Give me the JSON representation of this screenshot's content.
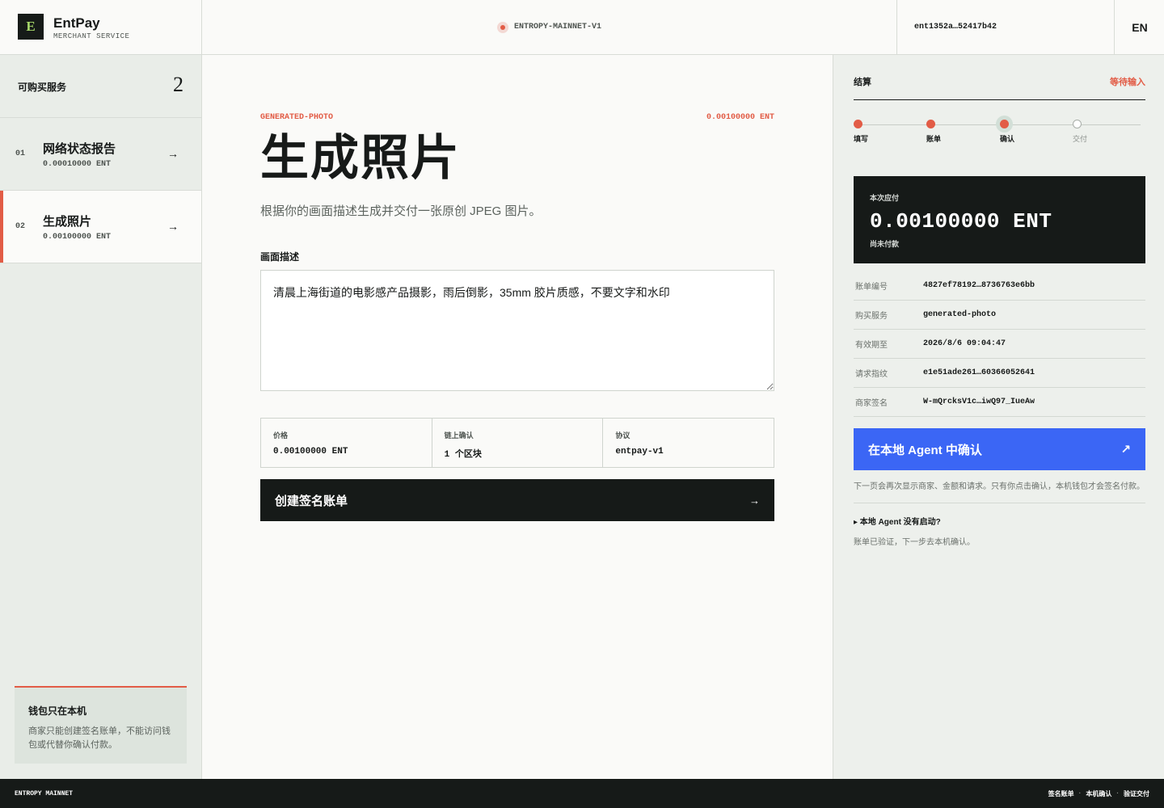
{
  "header": {
    "logo_letter": "E",
    "brand_name": "EntPay",
    "brand_sub": "MERCHANT SERVICE",
    "network": "ENTROPY-MAINNET-V1",
    "account": "ent1352a…52417b42",
    "language": "EN"
  },
  "sidebar": {
    "heading": "可购买服务",
    "count": "2",
    "services": [
      {
        "num": "01",
        "name": "网络状态报告",
        "price": "0.00010000 ENT",
        "arrow": "→",
        "active": false
      },
      {
        "num": "02",
        "name": "生成照片",
        "price": "0.00100000 ENT",
        "arrow": "→",
        "active": true
      }
    ],
    "notice": {
      "title": "钱包只在本机",
      "body": "商家只能创建签名账单，不能访问钱包或代替你确认付款。"
    }
  },
  "main": {
    "service_id": "GENERATED-PHOTO",
    "service_price": "0.00100000 ENT",
    "title": "生成照片",
    "description": "根据你的画面描述生成并交付一张原创 JPEG 图片。",
    "prompt_label": "画面描述",
    "prompt_value": "清晨上海街道的电影感产品摄影，雨后倒影，35mm 胶片质感，不要文字和水印",
    "stats": [
      {
        "label": "价格",
        "value": "0.00100000 ENT"
      },
      {
        "label": "链上确认",
        "value": "1 个区块"
      },
      {
        "label": "协议",
        "value": "entpay-v1"
      }
    ],
    "create_button": "创建签名账单",
    "create_arrow": "→"
  },
  "checkout": {
    "heading": "结算",
    "status": "等待输入",
    "steps": [
      {
        "label": "填写",
        "state": "done"
      },
      {
        "label": "账单",
        "state": "done"
      },
      {
        "label": "确认",
        "state": "current"
      },
      {
        "label": "交付",
        "state": "pending"
      }
    ],
    "amount_label": "本次应付",
    "amount": "0.00100000 ENT",
    "amount_status": "尚未付款",
    "details": [
      {
        "key": "账单编号",
        "value": "4827ef78192…8736763e6bb"
      },
      {
        "key": "购买服务",
        "value": "generated-photo"
      },
      {
        "key": "有效期至",
        "value": "2026/8/6 09:04:47"
      },
      {
        "key": "请求指纹",
        "value": "e1e51ade261…60366052641"
      },
      {
        "key": "商家签名",
        "value": "W-mQrcksV1c…iwQ97_IueAw"
      }
    ],
    "agent_button": "在本地 Agent 中确认",
    "agent_arrow": "↗",
    "agent_note": "下一页会再次显示商家、金额和请求。只有你点击确认，本机钱包才会签名付款。",
    "faq": "▸ 本地 Agent 没有启动?",
    "faq_note": "账单已验证，下一步去本机确认。"
  },
  "footer": {
    "left": "ENTROPY MAINNET",
    "links": [
      "签名账单",
      "本机确认",
      "验证交付"
    ],
    "separator": "·"
  },
  "colors": {
    "accent": "#e25c46",
    "dark": "#161a18",
    "primary_button": "#3b66f5",
    "logo_letter": "#a7d86a"
  }
}
